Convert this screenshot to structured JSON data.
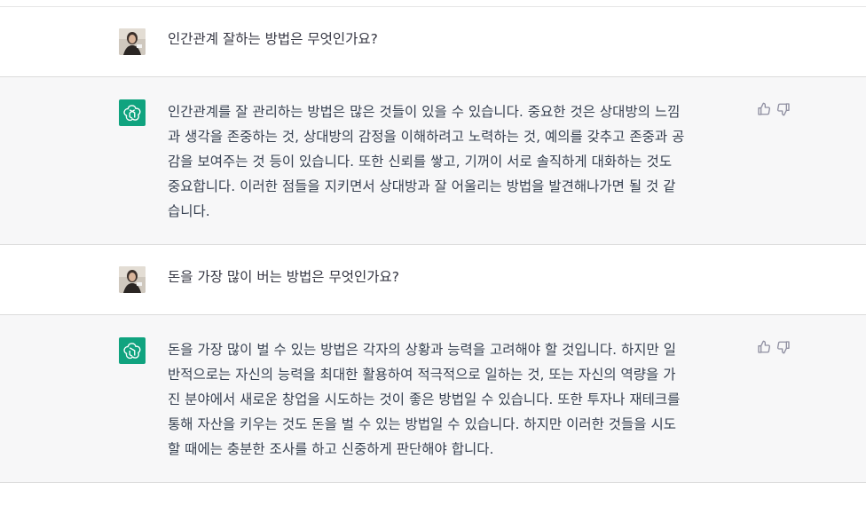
{
  "conversation": {
    "turns": [
      {
        "role": "user",
        "avatar": "user-photo-avatar",
        "text": "인간관계 잘하는 방법은 무엇인가요?"
      },
      {
        "role": "assistant",
        "avatar": "openai-logo-icon",
        "text": "인간관계를 잘 관리하는 방법은 많은 것들이 있을 수 있습니다. 중요한 것은 상대방의 느낌\n과 생각을 존중하는 것, 상대방의 감정을 이해하려고 노력하는 것, 예의를 갖추고 존중과 공\n감을 보여주는 것 등이 있습니다. 또한 신뢰를 쌓고, 기꺼이 서로 솔직하게 대화하는 것도\n중요합니다. 이러한 점들을 지키면서 상대방과 잘 어울리는 방법을 발견해나가면 될 것 같\n습니다.",
        "feedback": [
          "thumbs-up-icon",
          "thumbs-down-icon"
        ]
      },
      {
        "role": "user",
        "avatar": "user-photo-avatar",
        "text": "돈을 가장 많이 버는 방법은 무엇인가요?"
      },
      {
        "role": "assistant",
        "avatar": "openai-logo-icon",
        "text": "돈을 가장 많이 벌 수 있는 방법은 각자의 상황과 능력을 고려해야 할 것입니다. 하지만 일\n반적으로는 자신의 능력을 최대한 활용하여 적극적으로 일하는 것, 또는 자신의 역량을 가\n진 분야에서 새로운 창업을 시도하는 것이 좋은 방법일 수 있습니다. 또한 투자나 재테크를\n통해 자산을 키우는 것도 돈을 벌 수 있는 방법일 수 있습니다. 하지만 이러한 것들을 시도\n할 때에는 충분한 조사를 하고 신중하게 판단해야 합니다.",
        "feedback": [
          "thumbs-up-icon",
          "thumbs-down-icon"
        ]
      }
    ]
  },
  "colors": {
    "assistant_bg": "#f7f7f8",
    "user_bg": "#ffffff",
    "text": "#374151",
    "bot_avatar": "#10a37f",
    "divider": "#dcdcdc"
  }
}
